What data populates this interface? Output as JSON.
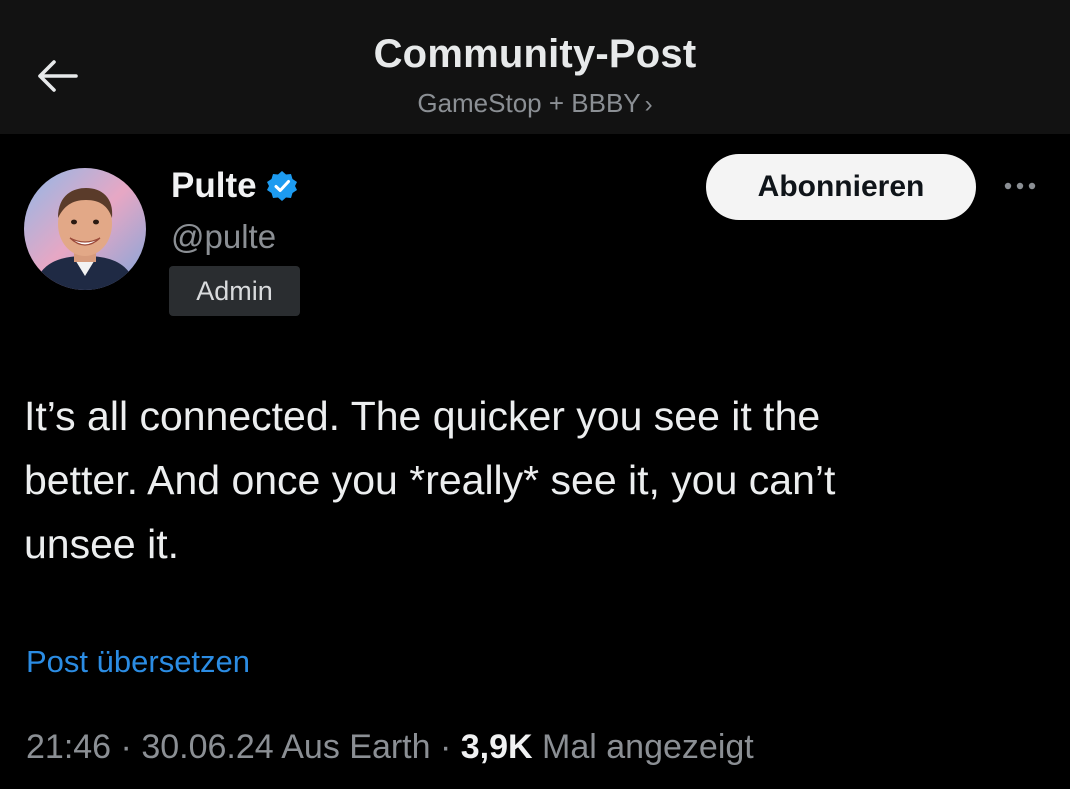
{
  "header": {
    "title": "Community-Post",
    "subtitle": "GameStop + BBBY",
    "subtitle_chevron": "›",
    "back_icon": "arrow-left-icon"
  },
  "author": {
    "name": "Pulte",
    "verified": true,
    "handle": "@pulte",
    "role_badge": "Admin",
    "avatar_icon": "profile-photo"
  },
  "actions": {
    "subscribe_label": "Abonnieren",
    "more_icon": "more-dots-icon"
  },
  "post": {
    "text": "It’s all connected. The quicker you see it the\nbetter. And once you *really* see it, you can’t\nunsee it.",
    "translate_label": "Post übersetzen"
  },
  "meta": {
    "time": "21:46",
    "sep1": " · ",
    "date": "30.06.24",
    "location": " Aus Earth",
    "sep2": " · ",
    "views_count": "3,9K",
    "views_label": " Mal angezeigt"
  },
  "colors": {
    "background": "#000000",
    "header_bg": "#121212",
    "link": "#2b8ce3",
    "verified": "#1d9bf0",
    "muted_text": "#8b8f94"
  }
}
